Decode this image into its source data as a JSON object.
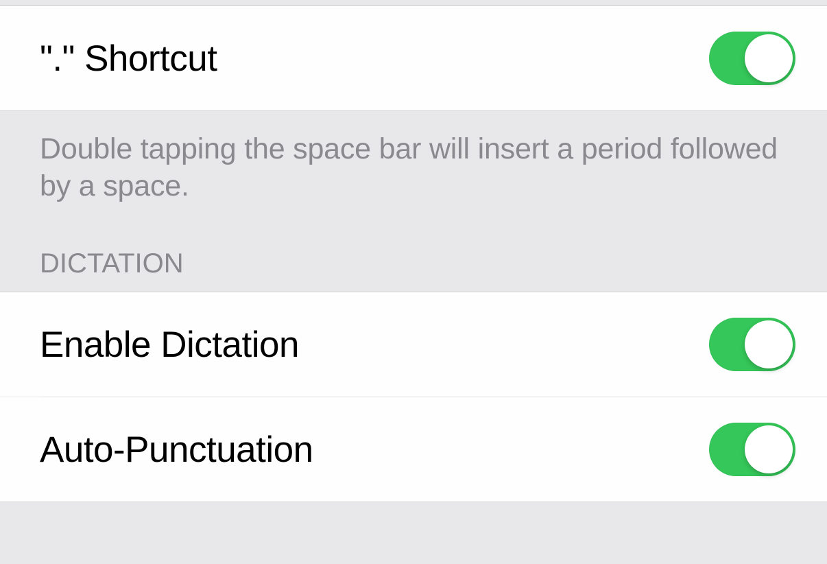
{
  "shortcut": {
    "label": "\".\" Shortcut",
    "footer": "Double tapping the space bar will insert a period followed by a space.",
    "on": true
  },
  "dictation": {
    "header": "DICTATION",
    "enable_label": "Enable Dictation",
    "enable_on": true,
    "autopunct_label": "Auto-Punctuation",
    "autopunct_on": true
  },
  "colors": {
    "toggle_on": "#35c759",
    "group_bg": "#e8e8ea",
    "row_bg": "#fefefe",
    "divider": "#d0d0d2",
    "footer_text": "#8a8a8e"
  }
}
